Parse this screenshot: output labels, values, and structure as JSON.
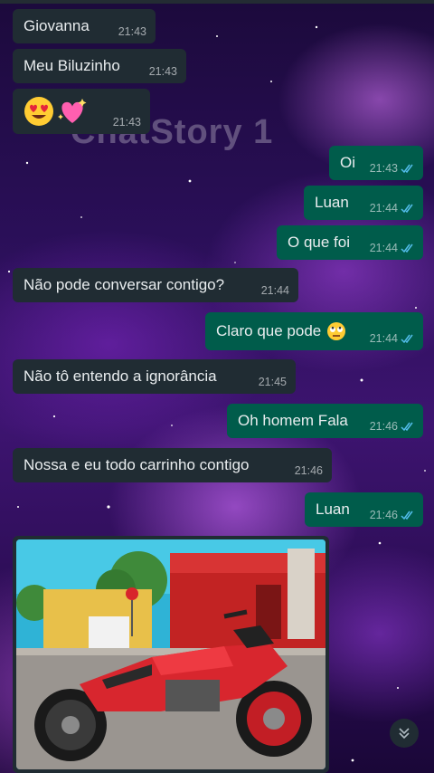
{
  "contact_name": "Giovanna",
  "watermark": "ChatStory 1",
  "messages": [
    {
      "text": "Giovanna",
      "time": "21:43"
    },
    {
      "text": "Meu Biluzinho",
      "time": "21:43"
    },
    {
      "emojis": [
        "heart-eyes-emoji",
        "sparkling-heart-emoji"
      ],
      "time": "21:43"
    },
    {
      "text": "Oi",
      "time": "21:43"
    },
    {
      "text": "Luan",
      "time": "21:44"
    },
    {
      "text": "O que foi",
      "time": "21:44"
    },
    {
      "text": "Não pode conversar contigo?",
      "time": "21:44"
    },
    {
      "text": "Claro que pode",
      "emoji": "rolling-eyes-emoji",
      "time": "21:44"
    },
    {
      "text": "Não tô entendo a ignorância",
      "time": "21:45"
    },
    {
      "text": "Oh homem Fala",
      "time": "21:46"
    },
    {
      "text": "Nossa e eu todo carrinho contigo",
      "time": "21:46"
    },
    {
      "text": "Luan",
      "time": "21:46"
    }
  ],
  "photo": {
    "description_icon": "red-motorcycle-photo"
  },
  "colors": {
    "incoming": "#202c33",
    "outgoing": "#005c4b",
    "read_ticks": "#53bdeb"
  },
  "icons": {
    "scroll_down": "double-chevron-down-icon"
  }
}
